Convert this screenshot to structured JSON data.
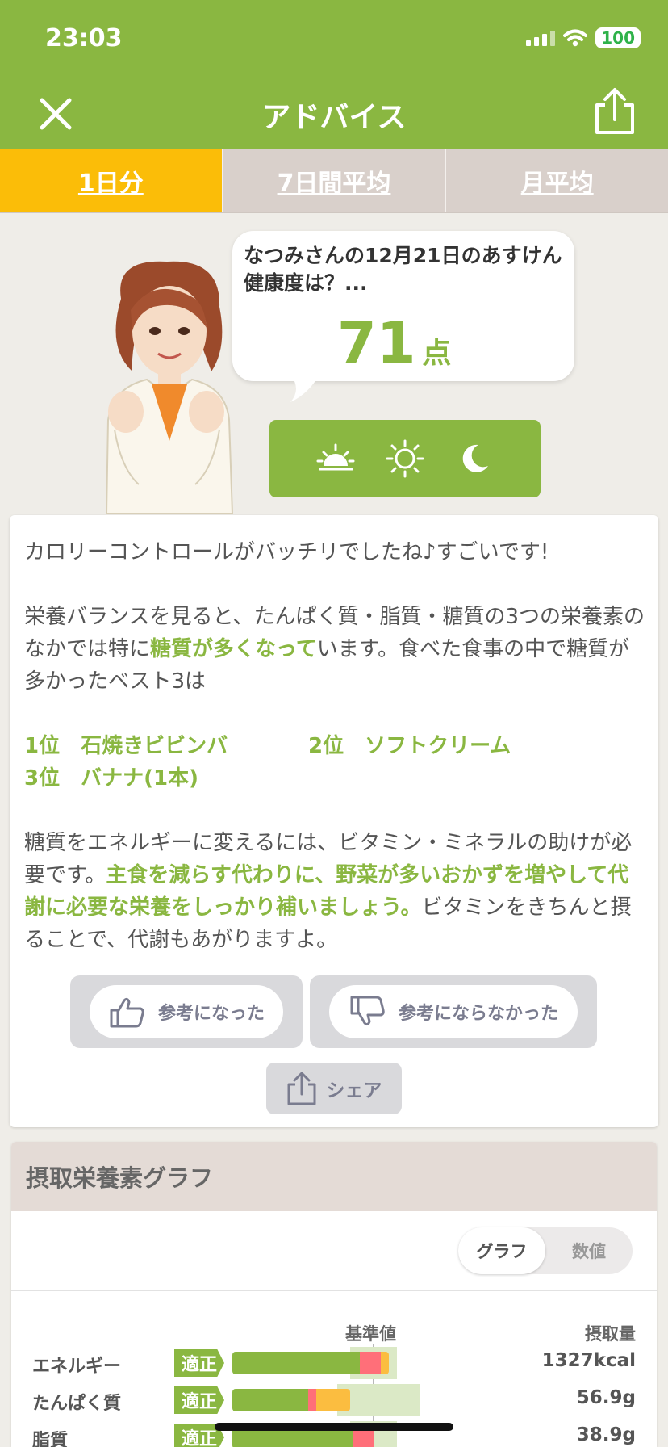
{
  "status_bar": {
    "time": "23:03",
    "battery": "100"
  },
  "nav": {
    "title": "アドバイス"
  },
  "tabs": [
    "1日分",
    "7日間平均",
    "月平均"
  ],
  "bubble": {
    "text": "なつみさんの12月21日のあすけん健康度は？...",
    "score": "71",
    "unit": "点"
  },
  "advice": {
    "line1": "カロリーコントロールがバッチリでしたね♪すごいです!",
    "p2_before": "栄養バランスを見ると、たんぱく質・脂質・糖質の3つの栄養素のなかでは特に",
    "p2_highlight": "糖質が多くなって",
    "p2_after": "います。食べた食事の中で糖質が多かったベスト3は",
    "ranks": [
      "1位　石焼きビビンバ",
      "2位　ソフトクリーム",
      "3位　バナナ(1本)"
    ],
    "p4_before": "糖質をエネルギーに変えるには、ビタミン・ミネラルの助けが必要です。",
    "p4_highlight": "主食を減らす代わりに、野菜が多いおかずを増やして代謝に必要な栄養をしっかり補いましょう。",
    "p4_after": "ビタミンをきちんと摂ることで、代謝もあがりますよ。"
  },
  "feedback": {
    "helpful": "参考になった",
    "not_helpful": "参考にならなかった",
    "share": "シェア"
  },
  "graph": {
    "title": "摂取栄養素グラフ",
    "toggle": [
      "グラフ",
      "数値"
    ],
    "col_reference": "基準値",
    "col_intake": "摂取量",
    "rows": [
      {
        "name": "エネルギー",
        "status": "適正",
        "value": "1327kcal"
      },
      {
        "name": "たんぱく質",
        "status": "適正",
        "value": "56.9g"
      },
      {
        "name": "脂質",
        "status": "適正",
        "value": "38.9g"
      }
    ]
  },
  "colors": {
    "brand_green": "#8ab741",
    "tab_active": "#fbbd08",
    "over": "#ff6f79",
    "caution": "#fbbd40"
  }
}
